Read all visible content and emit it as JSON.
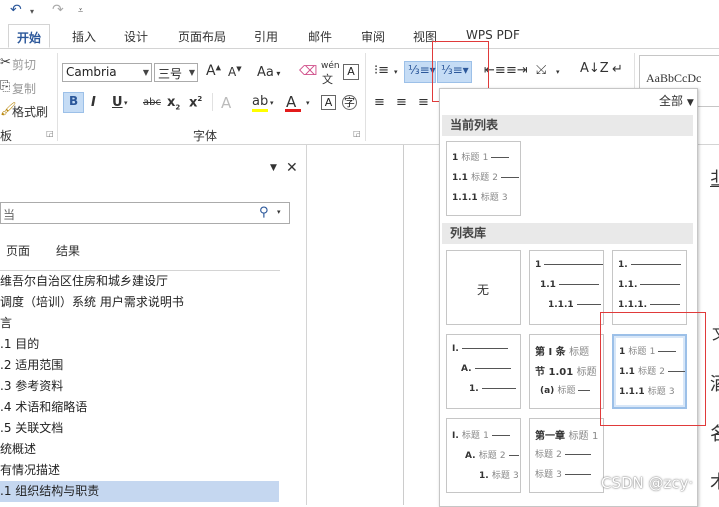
{
  "quick_access": {
    "undo_icon": "undo-icon",
    "redo_icon": "redo-icon",
    "customize_icon": "customize-icon"
  },
  "tabs": [
    {
      "label": "开始",
      "active": true
    },
    {
      "label": "插入"
    },
    {
      "label": "设计"
    },
    {
      "label": "页面布局"
    },
    {
      "label": "引用"
    },
    {
      "label": "邮件"
    },
    {
      "label": "审阅"
    },
    {
      "label": "视图"
    },
    {
      "label": "WPS PDF"
    }
  ],
  "clipboard": {
    "cut": "剪切",
    "copy": "复制",
    "format_painter": "格式刷",
    "group_label": "板"
  },
  "font": {
    "name": "Cambria",
    "size": "三号",
    "group_label": "字体",
    "case_label": "Aa",
    "phonetic_label": "wén"
  },
  "styles_preview": "AaBbCcDc",
  "gallery": {
    "filter_label": "全部",
    "current_header": "当前列表",
    "library_header": "列表库",
    "none_label": "无",
    "heading_word": "标题",
    "chapter_cell": {
      "line1_a": "第 Ⅰ 条",
      "line2_a": "节 1.01",
      "line3_a": "(a)",
      "line1_b": "第一章"
    },
    "roman": {
      "l1": "Ⅰ.",
      "l2": "A.",
      "l3": "1."
    }
  },
  "nav": {
    "search_placeholder": "当",
    "tab_pages": "页面",
    "tab_results": "结果",
    "items": [
      "维吾尔自治区住房和城乡建设厅",
      "调度（培训）系统 用户需求说明书",
      "言",
      ".1 目的",
      ".2 适用范围",
      ".3 参考资料",
      ".4 术语和缩略语",
      ".5 关联文档",
      "统概述",
      "有情况描述",
      ".1 组织结构与职责"
    ]
  },
  "doc_fragments": [
    "丠",
    "文",
    "酒",
    "名",
    "术"
  ],
  "watermark": "CSDN @zcy·"
}
